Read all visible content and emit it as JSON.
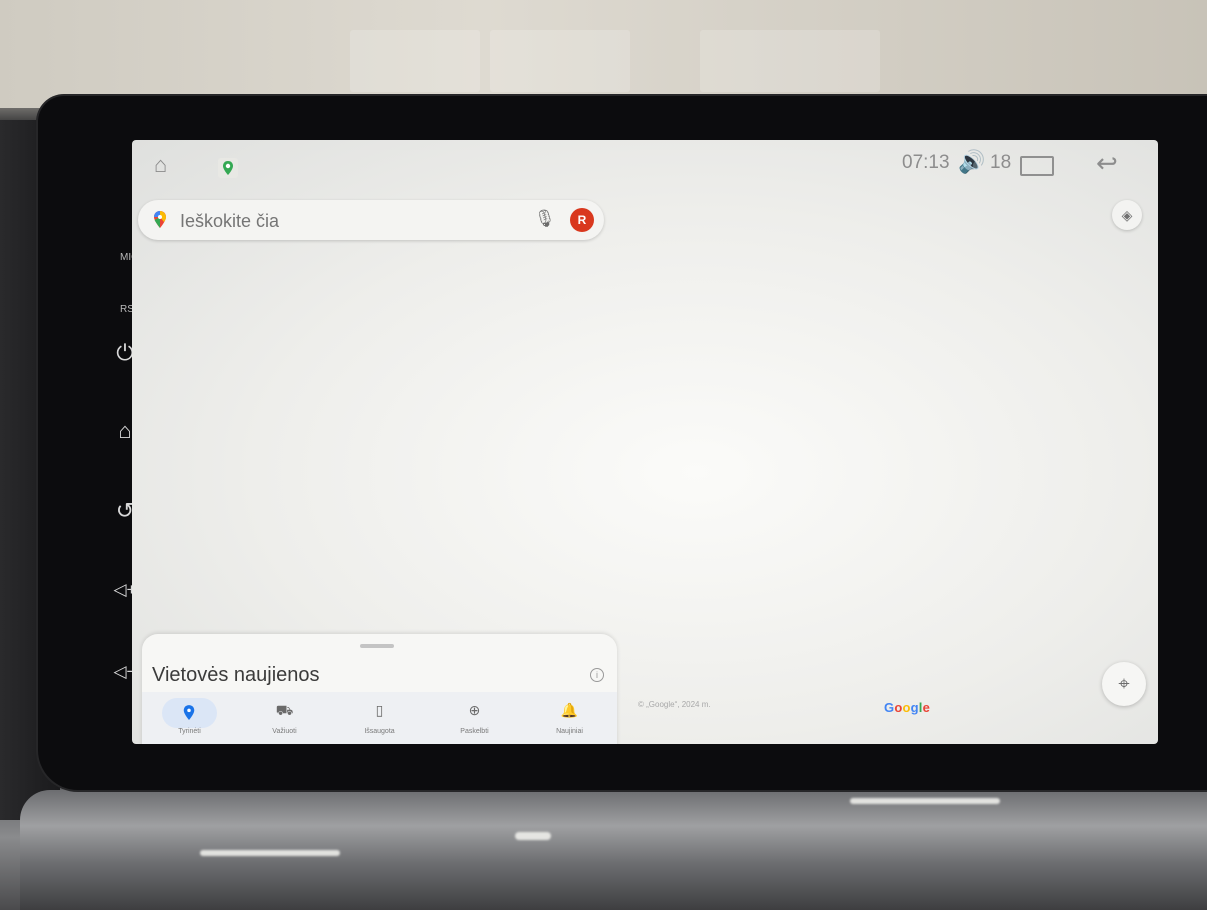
{
  "hardware": {
    "mic_label": "MIC",
    "rst_label": "RST",
    "buttons": [
      {
        "name": "power",
        "icon": "power-icon",
        "glyph": "⏻"
      },
      {
        "name": "home",
        "icon": "home-icon",
        "glyph": "⌂"
      },
      {
        "name": "back",
        "icon": "back-icon",
        "glyph": "↺"
      },
      {
        "name": "volume-up",
        "icon": "volume-up-icon",
        "glyph": "◁+"
      },
      {
        "name": "volume-down",
        "icon": "volume-down-icon",
        "glyph": "◁−"
      }
    ]
  },
  "statusbar": {
    "time": "07:13",
    "volume_level": "18",
    "home_glyph": "⌂",
    "volume_glyph": "🔊",
    "back_glyph": "↩"
  },
  "search": {
    "placeholder": "Ieškokite čia",
    "avatar_initial": "R"
  },
  "map": {
    "copyright": "© „Google“, 2024 m.",
    "logo": "Google",
    "layers_glyph": "◈",
    "locate_glyph": "⌖"
  },
  "sheet": {
    "title": "Vietovės naujienos",
    "info_glyph": "i"
  },
  "tabs": [
    {
      "label": "Tyrinėti",
      "glyph": "⬤",
      "active": true
    },
    {
      "label": "Važiuoti",
      "glyph": "⛟",
      "active": false
    },
    {
      "label": "Išsaugota",
      "glyph": "▯",
      "active": false
    },
    {
      "label": "Paskelbti",
      "glyph": "⊕",
      "active": false
    },
    {
      "label": "Naujiniai",
      "glyph": "🔔",
      "active": false
    }
  ],
  "colors": {
    "accent": "#1a73e8",
    "avatar": "#d9381e",
    "google_blue": "#4285f4",
    "google_red": "#ea4335",
    "google_yellow": "#fbbc05",
    "google_green": "#34a853"
  }
}
